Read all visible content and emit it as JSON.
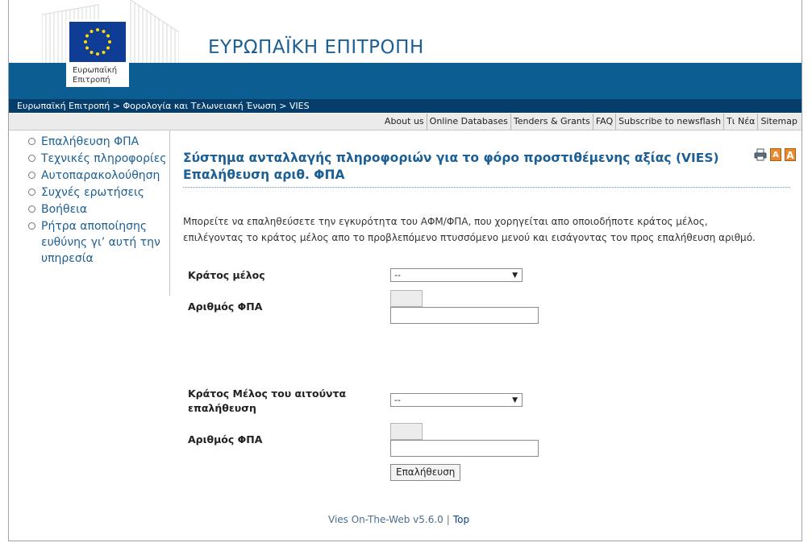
{
  "header": {
    "site_title": "ΕΥΡΩΠΑΪΚΗ ΕΠΙΤΡΟΠΗ",
    "logo_text_line1": "Ευρωπαϊκή",
    "logo_text_line2": "Επιτροπή"
  },
  "breadcrumb": {
    "item1": "Ευρωπαϊκή Επιτροπή",
    "item2": "Φορολογία και Τελωνειακή Ένωση",
    "item3": "VIES",
    "separator": ">"
  },
  "toplinks": [
    "About us",
    "Online Databases",
    "Tenders & Grants",
    "FAQ",
    "Subscribe to newsflash",
    "Τι Νέα",
    "Sitemap"
  ],
  "sidebar": {
    "items": [
      {
        "label": "Επαλήθευση ΦΠΑ"
      },
      {
        "label": "Τεχνικές πληροφορίες"
      },
      {
        "label": "Αυτοπαρακολούθηση"
      },
      {
        "label": "Συχνές ερωτήσεις"
      },
      {
        "label": "Βοήθεια"
      },
      {
        "label": "Ρήτρα αποποίησης ευθύνης γι’ αυτή την υπηρεσία"
      }
    ]
  },
  "main": {
    "title_line1": "Σύστημα ανταλλαγής πληροφοριών για το φόρο προστιθέμενης αξίας (VIES)",
    "title_line2": "Επαλήθευση αριθ. ΦΠΑ",
    "intro_line1": "Μπορείτε να επαληθεύσετε την εγκυρότητα του ΑΦΜ/ΦΠΑ, που χορηγείται απο οποιοδήποτε κράτος μέλος,",
    "intro_line2": "επιλέγοντας το κράτος μέλος απο το προβλεπόμενο πτυσσόμενο μενού και εισάγοντας τον προς επαλήθευση αριθμό.",
    "tools": {
      "small_font": "A",
      "large_font": "A"
    }
  },
  "form": {
    "member_state_label": "Κράτος μέλος",
    "member_state_value": "--",
    "vat_number_label": "Αριθμός ΦΠΑ",
    "vat_number_value": "",
    "requester_state_label_line1": "Κράτος Μέλος του αιτούντα",
    "requester_state_label_line2": "επαλήθευση",
    "requester_state_value": "--",
    "requester_vat_label": "Αριθμός ΦΠΑ",
    "requester_vat_value": "",
    "verify_button": "Επαλήθευση"
  },
  "footer": {
    "version": "Vies On-The-Web v5.6.0",
    "divider": "|",
    "top_link": "Top"
  },
  "colors": {
    "brand_blue": "#0b5d92",
    "breadcrumb_bg": "#053e6a",
    "link_blue": "#1c5f94",
    "eu_flag": "#0f3c95",
    "star_yellow": "#ffdd00"
  }
}
